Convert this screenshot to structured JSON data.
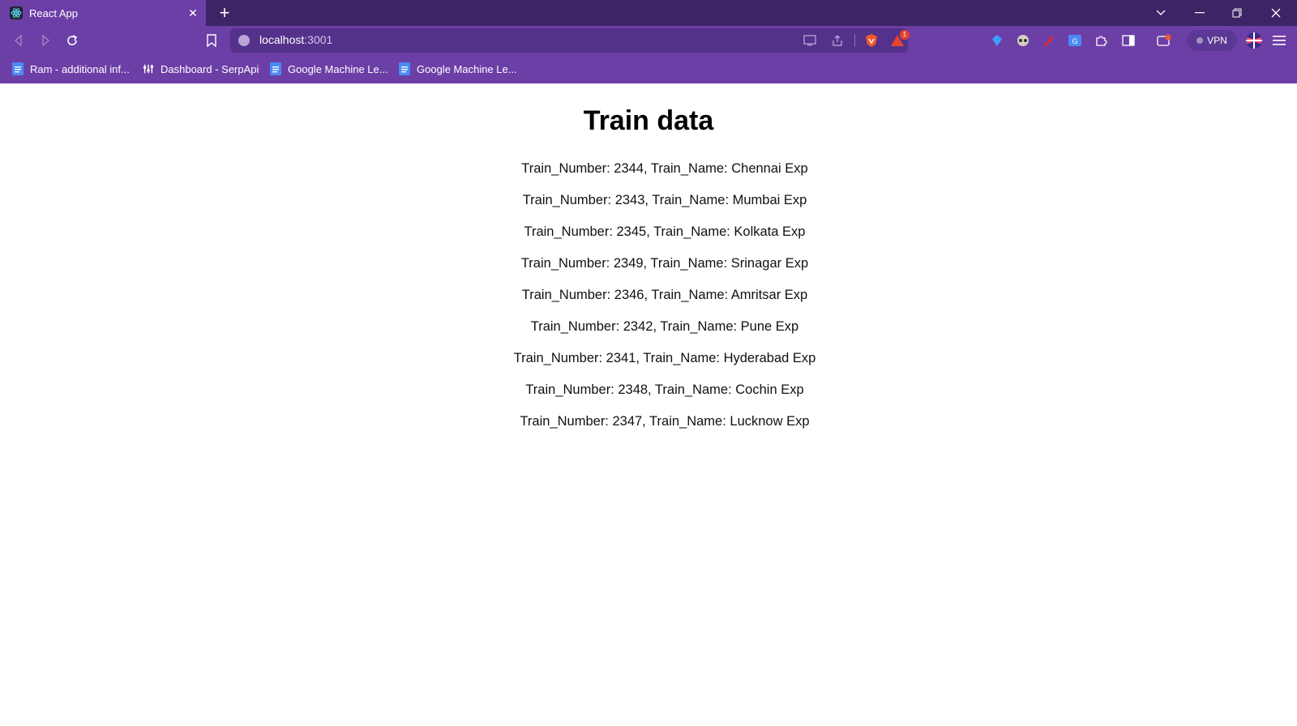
{
  "browser": {
    "tab": {
      "title": "React App"
    },
    "address": {
      "host": "localhost",
      "port": ":3001"
    },
    "shields_count": "1",
    "vpn_label": "VPN",
    "bookmarks": [
      {
        "label": "Ram - additional inf...",
        "icon": "doc-icon"
      },
      {
        "label": "Dashboard - SerpApi",
        "icon": "serpapi-icon"
      },
      {
        "label": "Google Machine Le...",
        "icon": "doc-icon"
      },
      {
        "label": "Google Machine Le...",
        "icon": "doc-icon"
      }
    ],
    "colors": {
      "tabstrip": "#3d2466",
      "toolbar": "#6c3fa7",
      "omnibox": "#54318a"
    }
  },
  "page": {
    "title": "Train data",
    "trains": [
      {
        "text": "Train_Number: 2344, Train_Name: Chennai Exp"
      },
      {
        "text": "Train_Number: 2343, Train_Name: Mumbai Exp"
      },
      {
        "text": "Train_Number: 2345, Train_Name: Kolkata Exp"
      },
      {
        "text": "Train_Number: 2349, Train_Name: Srinagar Exp"
      },
      {
        "text": "Train_Number: 2346, Train_Name: Amritsar Exp"
      },
      {
        "text": "Train_Number: 2342, Train_Name: Pune Exp"
      },
      {
        "text": "Train_Number: 2341, Train_Name: Hyderabad Exp"
      },
      {
        "text": "Train_Number: 2348, Train_Name: Cochin Exp"
      },
      {
        "text": "Train_Number: 2347, Train_Name: Lucknow Exp"
      }
    ]
  }
}
